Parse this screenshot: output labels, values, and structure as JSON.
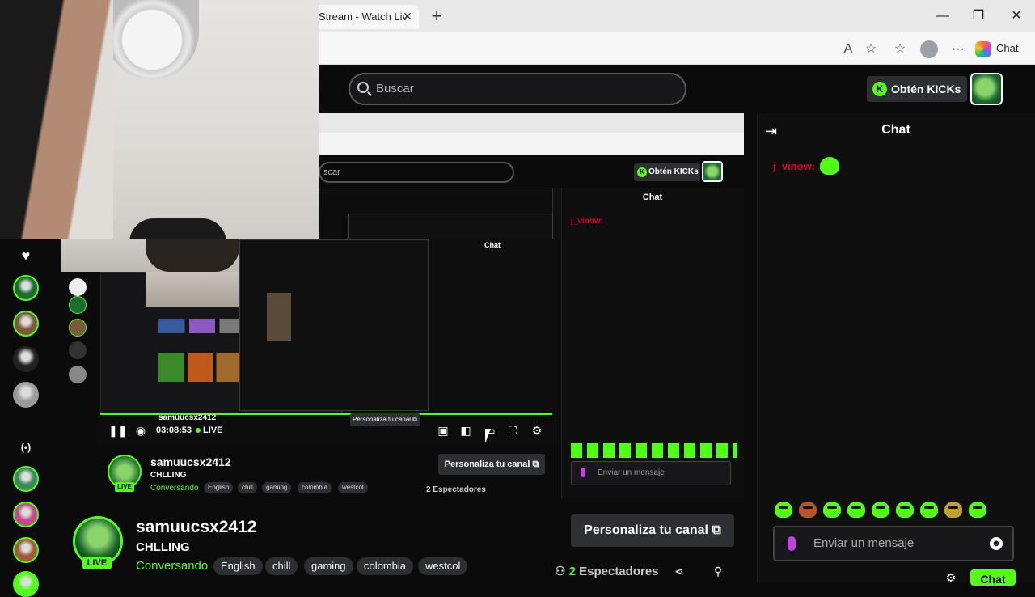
{
  "browser": {
    "tab_title": "Stream - Watch Liv",
    "tab_close": "✕",
    "new_tab": "+",
    "minimize": "—",
    "restore": "❐",
    "close": "✕",
    "read_aloud": "A",
    "favorite": "☆",
    "favorites_bar": "☆",
    "more": "···",
    "chat_label": "Chat"
  },
  "header": {
    "search_placeholder": "Buscar",
    "get_kicks": "Obtén KICKs",
    "kick_letter": "K"
  },
  "nested": {
    "search_text": "scar",
    "get_kicks": "Obtén KICKs",
    "chat_title": "Chat",
    "chat_user": "j_vinow:",
    "input_placeholder": "Enviar un mensaje",
    "mid_chat_title": "Chat",
    "player_time": "03:08:53",
    "player_live": "LIVE",
    "player_name": "samuucsx2412",
    "player_button": "Personaliza tu canal ⧉",
    "stream_name": "samuucsx2412",
    "stream_title": "CHLLING",
    "stream_category": "Conversando",
    "tags": [
      "English",
      "chill",
      "gaming",
      "colombia",
      "westcol"
    ],
    "button": "Personaliza tu canal ⧉",
    "viewers": "2 Espectadores",
    "live_badge": "LIVE"
  },
  "sidebar": {
    "heart": "♥",
    "live_icon": "(•)",
    "avatar_colors": [
      "#1e6b2f",
      "#7a5a3a",
      "#222222",
      "#9a9a9a"
    ],
    "avatar_colors_lower": [
      "#3a8a5a",
      "#c04a8a",
      "#a05a3a",
      "#53fc18"
    ]
  },
  "stream": {
    "channel_name": "samuucsx2412",
    "title": "CHLLING",
    "category": "Conversando",
    "tags": [
      "English",
      "chill",
      "gaming",
      "colombia",
      "westcol"
    ],
    "live_badge": "LIVE",
    "customize_button": "Personaliza tu canal ⧉",
    "viewer_count": "2",
    "viewer_label": "Espectadores",
    "share_icon": "⋖",
    "follow_icon": "⚲"
  },
  "chat": {
    "collapse_icon": "⇥",
    "title": "Chat",
    "messages": [
      {
        "user": "j_vinow:"
      }
    ],
    "input_placeholder": "Enviar un mensaje",
    "emoji_icon": "☻",
    "settings_icon": "⚙",
    "send_label": "Chat"
  },
  "colors": {
    "accent": "#53fc18",
    "background": "#0b0b0c",
    "panel": "#2d2f33",
    "chat_user": "#e0002a"
  }
}
